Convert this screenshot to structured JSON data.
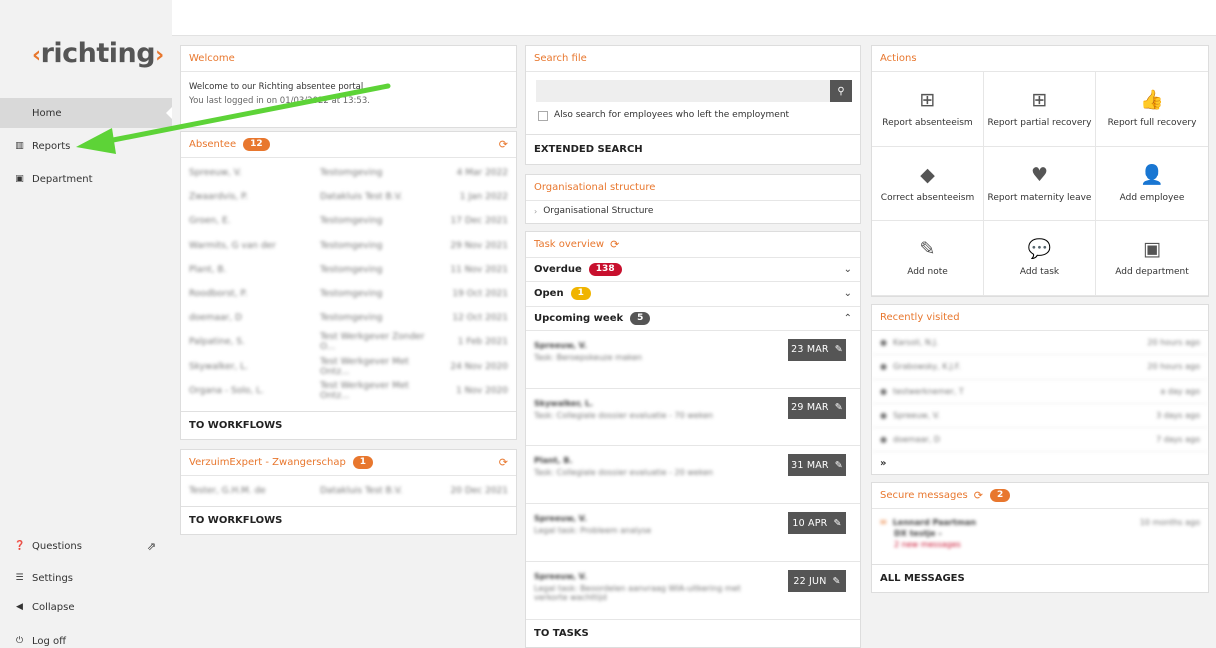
{
  "sidebar": {
    "logo_text": "richting",
    "nav": {
      "home": "Home",
      "reports": "Reports",
      "department": "Department",
      "questions": "Questions",
      "settings": "Settings",
      "collapse": "Collapse",
      "logoff": "Log off"
    }
  },
  "welcome": {
    "title": "Welcome",
    "line1": "Welcome to our Richting absentee portal",
    "line2": "You last logged in on 01/03/2022 at 13:53."
  },
  "absentee": {
    "title": "Absentee",
    "count": "12",
    "rows": [
      [
        "Spreeuw, V.",
        "Testomgeving",
        "4 Mar 2022"
      ],
      [
        "Zwaardvis, P.",
        "Datakluis Test B.V.",
        "1 Jan 2022"
      ],
      [
        "Groen, E.",
        "Testomgeving",
        "17 Dec 2021"
      ],
      [
        "Warmits, G van der",
        "Testomgeving",
        "29 Nov 2021"
      ],
      [
        "Plant, B.",
        "Testomgeving",
        "11 Nov 2021"
      ],
      [
        "Roodborst, P.",
        "Testomgeving",
        "19 Oct 2021"
      ],
      [
        "doemaar, D",
        "Testomgeving",
        "12 Oct 2021"
      ],
      [
        "Palpatine, S.",
        "Test Werkgever Zonder O...",
        "1 Feb 2021"
      ],
      [
        "Skywalker, L.",
        "Test Werkgever Met Ontz...",
        "24 Nov 2020"
      ],
      [
        "Organa - Solo, L.",
        "Test Werkgever Met Ontz...",
        "1 Nov 2020"
      ]
    ],
    "footer": "TO WORKFLOWS"
  },
  "verzuim": {
    "title": "VerzuimExpert - Zwangerschap",
    "count": "1",
    "rows": [
      [
        "Tester, G.H.M. de",
        "Datakluis Test B.V.",
        "20 Dec 2021"
      ]
    ],
    "footer": "TO WORKFLOWS"
  },
  "search": {
    "title": "Search file",
    "checkbox_label": "Also search for employees who left the employment",
    "extended": "EXTENDED SEARCH"
  },
  "org": {
    "title": "Organisational structure",
    "item": "Organisational Structure"
  },
  "tasks": {
    "title": "Task overview",
    "overdue_label": "Overdue",
    "overdue_count": "138",
    "open_label": "Open",
    "open_count": "1",
    "upcoming_label": "Upcoming week",
    "upcoming_count": "5",
    "items": [
      {
        "name": "Spreeuw, V.",
        "desc": "Task: Beroepskeuze maken",
        "date": "23 MAR"
      },
      {
        "name": "Skywalker, L.",
        "desc": "Task: Collegiale dossier evaluatie - 70 weken",
        "date": "29 MAR"
      },
      {
        "name": "Plant, B.",
        "desc": "Task: Collegiale dossier evaluatie - 20 weken",
        "date": "31 MAR"
      },
      {
        "name": "Spreeuw, V.",
        "desc": "Legal task: Probleem analyse",
        "date": "10 APR"
      },
      {
        "name": "Spreeuw, V.",
        "desc": "Legal task: Beoordelen aanvraag WIA-uitkering met verkorte wachttijd",
        "date": "22 JUN"
      }
    ],
    "footer": "TO TASKS"
  },
  "actions": {
    "title": "Actions",
    "items": [
      {
        "label": "Report absenteeism",
        "icon": "medkit-icon",
        "glyph": "⊞"
      },
      {
        "label": "Report partial recovery",
        "icon": "medkit-icon",
        "glyph": "⊞"
      },
      {
        "label": "Report full recovery",
        "icon": "thumbs-up-icon",
        "glyph": "👍"
      },
      {
        "label": "Correct absenteeism",
        "icon": "eraser-icon",
        "glyph": "◆"
      },
      {
        "label": "Report maternity leave",
        "icon": "heart-icon",
        "glyph": "♥"
      },
      {
        "label": "Add employee",
        "icon": "add-user-icon",
        "glyph": "👤"
      },
      {
        "label": "Add note",
        "icon": "pencil-icon",
        "glyph": "✎"
      },
      {
        "label": "Add task",
        "icon": "speech-bubble-icon",
        "glyph": "💬"
      },
      {
        "label": "Add department",
        "icon": "suitcase-icon",
        "glyph": "▣"
      }
    ]
  },
  "recent": {
    "title": "Recently visited",
    "rows": [
      [
        "Karsoli, N.J.",
        "20 hours ago"
      ],
      [
        "Grabowsky, K.J.F.",
        "20 hours ago"
      ],
      [
        "testwerknemer, T",
        "a day ago"
      ],
      [
        "Spreeuw, V.",
        "3 days ago"
      ],
      [
        "doemaar, D",
        "7 days ago"
      ]
    ],
    "more": "»"
  },
  "messages": {
    "title": "Secure messages",
    "count": "2",
    "sender": "Lennard Paartman",
    "subject": "DX testje -",
    "new": "2 new messages",
    "time": "10 months ago",
    "footer": "ALL MESSAGES"
  },
  "colors": {
    "accent": "#e8772e",
    "overdue": "#c8102e",
    "open": "#f0b400",
    "arrow": "#5dd337"
  }
}
